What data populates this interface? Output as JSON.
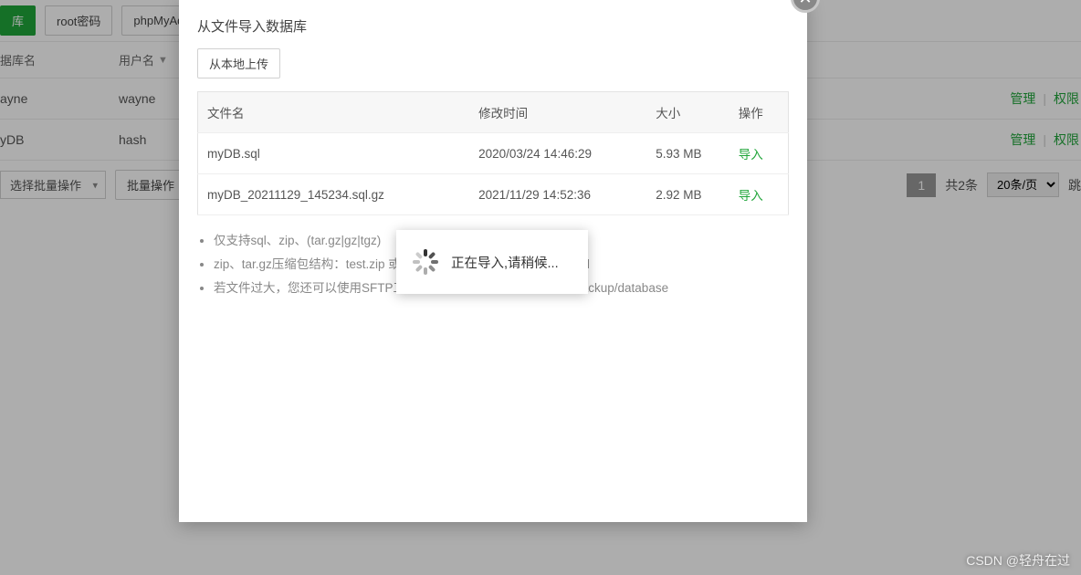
{
  "bg": {
    "top_buttons": {
      "add_db": "库",
      "root_pwd": "root密码",
      "phpmyadmin": "phpMyAd"
    },
    "table_header": {
      "dbname": "据库名",
      "username": "用户名"
    },
    "rows": [
      {
        "dbname": "ayne",
        "username": "wayne"
      },
      {
        "dbname": "yDB",
        "username": "hash"
      }
    ],
    "row_actions": {
      "manage": "管理",
      "perm": "权限"
    },
    "footer": {
      "batch_select": "选择批量操作",
      "batch_btn": "批量操作",
      "page_num": "1",
      "total": "共2条",
      "per_page": "20条/页",
      "jump": "跳"
    }
  },
  "modal": {
    "title": "从文件导入数据库",
    "upload_btn": "从本地上传",
    "th": {
      "name": "文件名",
      "mtime": "修改时间",
      "size": "大小",
      "op": "操作"
    },
    "files": [
      {
        "name": "myDB.sql",
        "mtime": "2020/03/24 14:46:29",
        "size": "5.93 MB",
        "op": "导入"
      },
      {
        "name": "myDB_20211129_145234.sql.gz",
        "mtime": "2021/11/29 14:52:36",
        "size": "2.92 MB",
        "op": "导入"
      }
    ],
    "hints": [
      "仅支持sql、zip、(tar.gz|gz|tgz)",
      "zip、tar.gz压缩包结构：test.zip 或 test.tar.gz 压缩包内必须是 test.sql",
      "若文件过大，您还可以使用SFTP工具，将数据库文件上传到/www/backup/database"
    ]
  },
  "toast": {
    "text": "正在导入,请稍候..."
  },
  "watermark": "CSDN @轻舟在过"
}
